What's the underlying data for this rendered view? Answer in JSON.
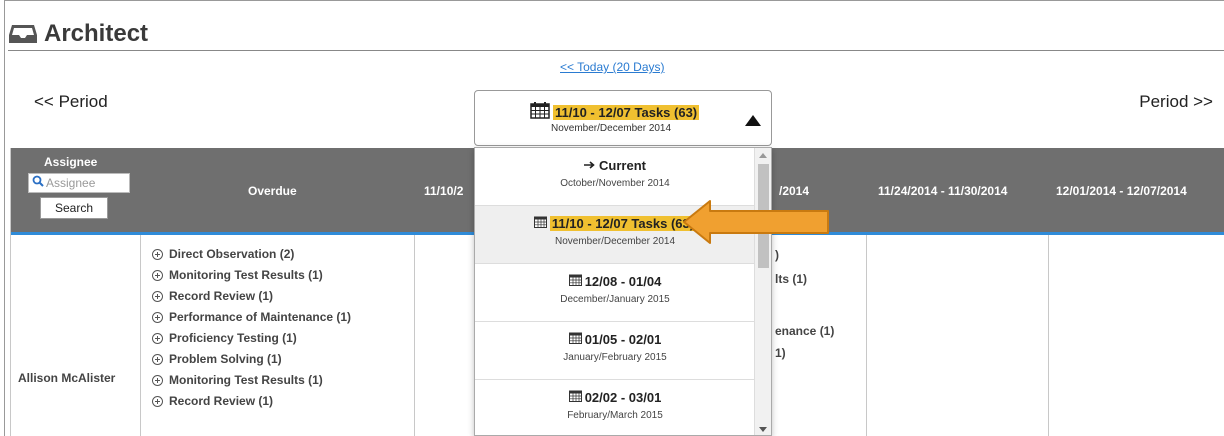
{
  "app": {
    "title": "Architect",
    "icon": "inbox-tray-icon"
  },
  "nav": {
    "today_link": "<< Today (20 Days)",
    "prev_period": "<< Period",
    "next_period": "Period >>"
  },
  "period_select": {
    "label": "11/10 - 12/07 Tasks (63)",
    "sublabel": "November/December 2014",
    "highlight_color": "#f0c030"
  },
  "grid": {
    "header_bg": "#6f6f6f",
    "accent": "#2f8bd8",
    "assignee_header": "Assignee",
    "assignee_search_placeholder": "Assignee",
    "search_button": "Search",
    "columns": [
      "Overdue",
      "11/10/2",
      "/2014",
      "11/24/2014 - 11/30/2014",
      "12/01/2014 - 12/07/2014"
    ],
    "assignee": "Allison McAlister",
    "overdue_tasks": [
      "Direct Observation  (2)",
      "Monitoring Test Results  (1)",
      "Record Review  (1)",
      "Performance of Maintenance  (1)",
      "Proficiency Testing  (1)",
      "Problem Solving  (1)",
      "Monitoring Test Results  (1)",
      "Record Review  (1)"
    ],
    "partial_col3": [
      ")",
      "lts  (1)",
      "enance  (1)",
      "1)"
    ]
  },
  "dropdown": {
    "items": [
      {
        "main": "Current",
        "sub": "October/November 2014",
        "icon": "arrow-right-icon",
        "highlight": false
      },
      {
        "main": "11/10 - 12/07 Tasks (63)",
        "sub": "November/December 2014",
        "icon": "calendar-icon",
        "highlight": true
      },
      {
        "main": "12/08 - 01/04",
        "sub": "December/January 2015",
        "icon": "calendar-icon",
        "highlight": false
      },
      {
        "main": "01/05 - 02/01",
        "sub": "January/February 2015",
        "icon": "calendar-icon",
        "highlight": false
      },
      {
        "main": "02/02 - 03/01",
        "sub": "February/March 2015",
        "icon": "calendar-icon",
        "highlight": false
      }
    ]
  },
  "callout": {
    "color": "#f0a030",
    "icon": "orange-arrow-icon"
  }
}
